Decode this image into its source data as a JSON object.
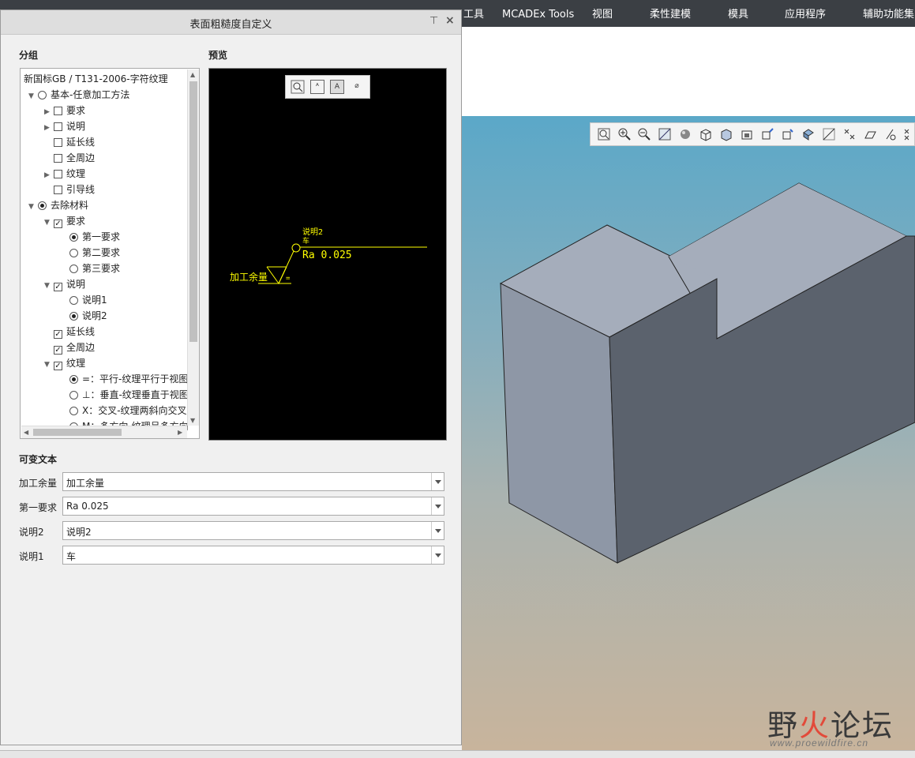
{
  "menubar": {
    "items": [
      "工具",
      "MCADEx Tools",
      "视图",
      "柔性建模",
      "模具",
      "应用程序",
      "辅助功能集"
    ]
  },
  "dialog": {
    "title": "表面粗糙度自定义",
    "pin_glyph": "⊤",
    "close_glyph": "×",
    "group_label": "分组",
    "preview_label": "预览",
    "variable_text_label": "可变文本"
  },
  "tree": {
    "items": [
      {
        "label": "新国标GB / T131-2006-字符纹理",
        "kind": "none",
        "expander": "none",
        "state": "off"
      },
      {
        "label": "基本-任意加工方法",
        "kind": "radio",
        "expander": "open",
        "state": "off"
      },
      {
        "label": "要求",
        "kind": "check",
        "expander": "closed",
        "state": "off"
      },
      {
        "label": "说明",
        "kind": "check",
        "expander": "closed",
        "state": "off"
      },
      {
        "label": "延长线",
        "kind": "check",
        "expander": "none",
        "state": "off"
      },
      {
        "label": "全周边",
        "kind": "check",
        "expander": "none",
        "state": "off"
      },
      {
        "label": "纹理",
        "kind": "check",
        "expander": "closed",
        "state": "off"
      },
      {
        "label": "引导线",
        "kind": "check",
        "expander": "none",
        "state": "off"
      },
      {
        "label": "去除材料",
        "kind": "radio",
        "expander": "open",
        "state": "on"
      },
      {
        "label": "要求",
        "kind": "check",
        "expander": "open",
        "state": "on"
      },
      {
        "label": "第一要求",
        "kind": "radio",
        "expander": "none",
        "state": "on"
      },
      {
        "label": "第二要求",
        "kind": "radio",
        "expander": "none",
        "state": "off"
      },
      {
        "label": "第三要求",
        "kind": "radio",
        "expander": "none",
        "state": "off"
      },
      {
        "label": "说明",
        "kind": "check",
        "expander": "open",
        "state": "on"
      },
      {
        "label": "说明1",
        "kind": "radio",
        "expander": "none",
        "state": "off"
      },
      {
        "label": "说明2",
        "kind": "radio",
        "expander": "none",
        "state": "on"
      },
      {
        "label": "延长线",
        "kind": "check",
        "expander": "none",
        "state": "on"
      },
      {
        "label": "全周边",
        "kind": "check",
        "expander": "none",
        "state": "on"
      },
      {
        "label": "纹理",
        "kind": "check",
        "expander": "open",
        "state": "on"
      },
      {
        "label": "=：平行-纹理平行于视图",
        "kind": "radio",
        "expander": "none",
        "state": "on"
      },
      {
        "label": "⊥：垂直-纹理垂直于视图",
        "kind": "radio",
        "expander": "none",
        "state": "off"
      },
      {
        "label": "X：交叉-纹理两斜向交叉",
        "kind": "radio",
        "expander": "none",
        "state": "off"
      },
      {
        "label": "M：多方向-纹理呈多方向",
        "kind": "radio",
        "expander": "none",
        "state": "off"
      }
    ],
    "check_glyph": "✓"
  },
  "preview": {
    "note_label": "说明2",
    "process_label": "车",
    "ra_text": "Ra 0.025",
    "allowance_text": "加工余量",
    "lay_symbol": "=",
    "toolbar_icons": [
      "zoom-fit-icon",
      "text-style-icon",
      "frame-text-icon",
      "diameter-symbol-icon"
    ],
    "tb_text_glyph": "ᴬ",
    "tb_frame_glyph": "A",
    "tb_diam_glyph": "⌀",
    "stroke_color": "#ffff00"
  },
  "variable_text": {
    "rows": [
      {
        "label": "加工余量",
        "value": "加工余量"
      },
      {
        "label": "第一要求",
        "value": "Ra 0.025"
      },
      {
        "label": "说明2",
        "value": "说明2"
      },
      {
        "label": "说明1",
        "value": "车"
      }
    ]
  },
  "graphics_toolbar": {
    "icons": [
      "refit-icon",
      "zoom-in-icon",
      "zoom-out-icon",
      "repaint-icon",
      "display-style-icon",
      "saved-views-icon",
      "view-manager-icon",
      "perspective-icon",
      "spin-center-icon",
      "annotation-display-icon",
      "plane-display-icon",
      "axis-display-icon",
      "point-display-icon",
      "csys-display-icon",
      "more-icon"
    ]
  },
  "watermark": {
    "text_dark": "野",
    "text_red": "火",
    "text_dark2": "论坛",
    "url": "www.proewildfire.cn"
  },
  "colors": {
    "viewport_top": "#5ba8c8",
    "viewport_bottom": "#c8b49c",
    "model_top": "#a5adbb",
    "model_front": "#8e97a6",
    "model_right": "#5b626d"
  }
}
